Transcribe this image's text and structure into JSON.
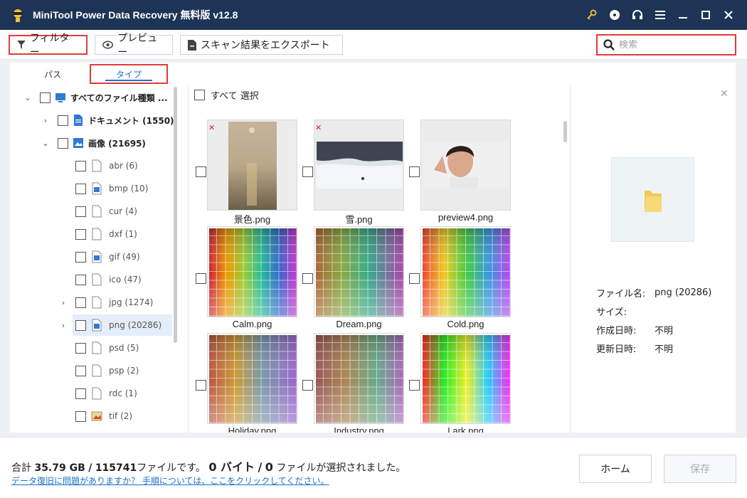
{
  "window": {
    "title": "MiniTool Power Data Recovery 無料版 v12.8"
  },
  "toolbar": {
    "filter_label": "フィルター",
    "preview_label": "プレビュー",
    "export_label": "スキャン結果をエクスポート",
    "search_placeholder": "検索"
  },
  "tabs": {
    "path": "パス",
    "type": "タイプ"
  },
  "tree": {
    "all": "すべてのファイル種類 ...",
    "documents": "ドキュメント (1550)",
    "images": "画像 (21695)",
    "types": [
      {
        "label": "abr (6)"
      },
      {
        "label": "bmp (10)"
      },
      {
        "label": "cur (4)"
      },
      {
        "label": "dxf (1)"
      },
      {
        "label": "gif (49)"
      },
      {
        "label": "ico (47)"
      },
      {
        "label": "jpg (1274)"
      },
      {
        "label": "png (20286)"
      },
      {
        "label": "psd (5)"
      },
      {
        "label": "psp (2)"
      },
      {
        "label": "rdc (1)"
      },
      {
        "label": "tif (2)"
      }
    ]
  },
  "grid": {
    "select_all": "すべて 選択",
    "items": [
      {
        "name": "景色.png"
      },
      {
        "name": "雪.png"
      },
      {
        "name": "preview4.png"
      },
      {
        "name": "Calm.png"
      },
      {
        "name": "Dream.png"
      },
      {
        "name": "Cold.png"
      },
      {
        "name": "Holiday.png"
      },
      {
        "name": "Industry.png"
      },
      {
        "name": "Lark.png"
      }
    ]
  },
  "preview": {
    "filename_label": "ファイル名:",
    "filename_value": "png (20286)",
    "size_label": "サイズ:",
    "size_value": "",
    "created_label": "作成日時:",
    "created_value": "不明",
    "modified_label": "更新日時:",
    "modified_value": "不明"
  },
  "footer": {
    "total_prefix": "合計",
    "total_size": "35.79 GB",
    "slash1": "/",
    "total_files": "115741",
    "files_suffix": "ファイルです。",
    "selected_size": "0 バイト",
    "slash2": "/",
    "selected_count": "0",
    "selected_suffix": "ファイルが選択されました。",
    "help_link": "データ復旧に問題がありますか？ 手順については、ここをクリックしてください。",
    "home_label": "ホーム",
    "save_label": "保存"
  },
  "colors": {
    "titlebar": "#1d3457",
    "highlight": "#e23a3a",
    "accent": "#1b73c9"
  }
}
